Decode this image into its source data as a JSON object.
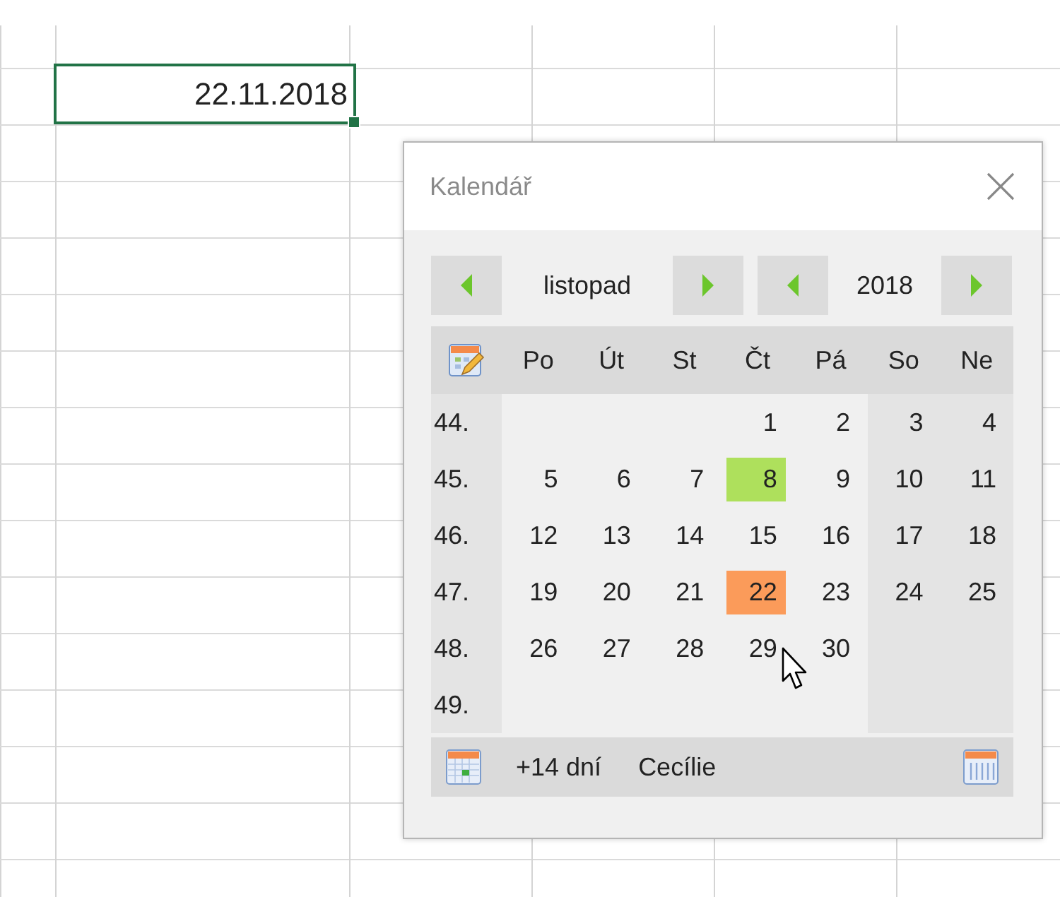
{
  "cell": {
    "value": "22.11.2018"
  },
  "dialog": {
    "title": "Kalendář",
    "month": "listopad",
    "year": "2018"
  },
  "weekdays": [
    "Po",
    "Út",
    "St",
    "Čt",
    "Pá",
    "So",
    "Ne"
  ],
  "weeks": [
    {
      "number": "44.",
      "days": [
        {
          "text": "1"
        },
        {
          "text": "2"
        },
        {
          "text": "3"
        },
        {
          "text": "4"
        }
      ]
    },
    {
      "number": "45.",
      "days": [
        {
          "text": "5"
        },
        {
          "text": "6"
        },
        {
          "text": "7"
        },
        {
          "text": "8",
          "color": "#aee05c"
        },
        {
          "text": "9"
        },
        {
          "text": "10"
        },
        {
          "text": "11"
        }
      ]
    },
    {
      "number": "46.",
      "days": [
        {
          "text": "12"
        },
        {
          "text": "13"
        },
        {
          "text": "14"
        },
        {
          "text": "15"
        },
        {
          "text": "16"
        },
        {
          "text": "17"
        },
        {
          "text": "18"
        }
      ]
    },
    {
      "number": "47.",
      "days": [
        {
          "text": "19"
        },
        {
          "text": "20"
        },
        {
          "text": "21"
        },
        {
          "text": "22",
          "color": "#fb9b5a"
        },
        {
          "text": "23"
        },
        {
          "text": "24"
        },
        {
          "text": "25"
        }
      ]
    },
    {
      "number": "48.",
      "days": [
        {
          "text": "26"
        },
        {
          "text": "27"
        },
        {
          "text": "28"
        },
        {
          "text": "29"
        },
        {
          "text": "30"
        }
      ]
    },
    {
      "number": "49."
    }
  ],
  "footer": {
    "offset": "+14 dní",
    "nameday": "Cecílie"
  }
}
